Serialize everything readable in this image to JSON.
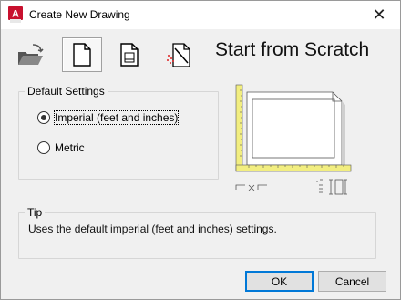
{
  "window": {
    "title": "Create New Drawing",
    "app_icon_letter": "A",
    "close_glyph": "✕"
  },
  "toolbar": {
    "items": [
      {
        "icon": "open-folder-icon",
        "active": false
      },
      {
        "icon": "blank-page-icon",
        "active": true
      },
      {
        "icon": "template-page-icon",
        "active": false
      },
      {
        "icon": "wizard-icon",
        "active": false
      }
    ]
  },
  "heading": "Start from Scratch",
  "settings": {
    "legend": "Default Settings",
    "options": [
      {
        "label": "Imperial (feet and inches)",
        "checked": true
      },
      {
        "label": "Metric",
        "checked": false
      }
    ]
  },
  "tip": {
    "legend": "Tip",
    "text": "Uses the default imperial (feet and inches) settings."
  },
  "buttons": {
    "ok": "OK",
    "cancel": "Cancel"
  },
  "colors": {
    "accent": "#0078d7",
    "app_icon": "#c8102e",
    "ruler": "#f2ee80"
  }
}
